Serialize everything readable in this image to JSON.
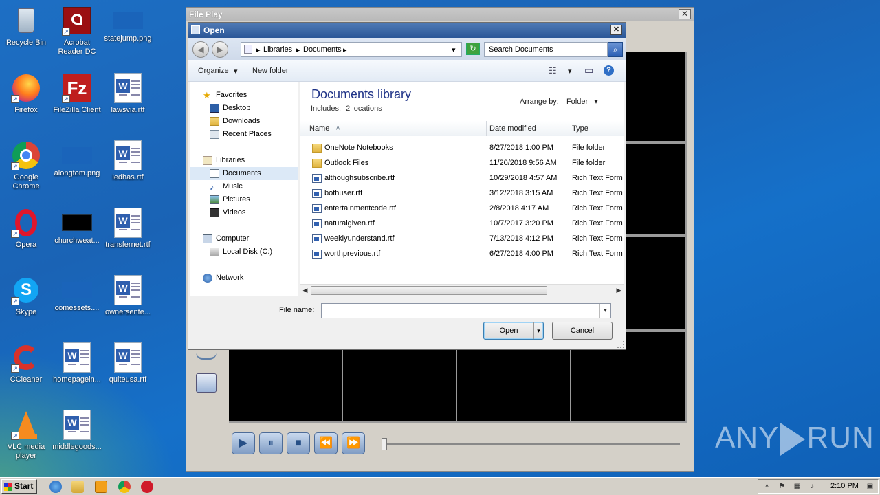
{
  "desktop": {
    "icons": [
      {
        "label": "Recycle Bin"
      },
      {
        "label": "Acrobat Reader DC"
      },
      {
        "label": "statejump.png"
      },
      {
        "label": "Firefox"
      },
      {
        "label": "FileZilla Client"
      },
      {
        "label": "lawsvia.rtf"
      },
      {
        "label": "Google Chrome"
      },
      {
        "label": "alongtom.png"
      },
      {
        "label": "ledhas.rtf"
      },
      {
        "label": "Opera"
      },
      {
        "label": "churchweat..."
      },
      {
        "label": "transfernet.rtf"
      },
      {
        "label": "Skype"
      },
      {
        "label": "comessets...."
      },
      {
        "label": "ownersente..."
      },
      {
        "label": "CCleaner"
      },
      {
        "label": "homepagein..."
      },
      {
        "label": "quiteusa.rtf"
      },
      {
        "label": "VLC media player"
      },
      {
        "label": "middlegoods..."
      }
    ],
    "watermark": {
      "left": "ANY",
      "right": "RUN"
    }
  },
  "file_play": {
    "title": "File Play",
    "close_glyph": "✕",
    "controls": {
      "play": "▶",
      "pause": "⏸",
      "stop": "■",
      "rewind": "⏪",
      "forward": "⏩"
    }
  },
  "open_dialog": {
    "title": "Open",
    "close_glyph": "✕",
    "back_glyph": "◀",
    "forward_glyph": "▶",
    "breadcrumb": {
      "part1": "Libraries",
      "part2": "Documents",
      "sep": "▸",
      "dropdown": "▾"
    },
    "refresh_glyph": "↻",
    "search_placeholder": "Search Documents",
    "search_glyph": "⌕",
    "toolbar": {
      "organize": "Organize",
      "new_folder": "New folder",
      "dropdown": "▾",
      "help": "?",
      "views_glyph": "☷",
      "preview_glyph": "▭"
    },
    "nav": {
      "favorites": "Favorites",
      "desktop": "Desktop",
      "downloads": "Downloads",
      "recent_places": "Recent Places",
      "libraries": "Libraries",
      "documents": "Documents",
      "music": "Music",
      "pictures": "Pictures",
      "videos": "Videos",
      "computer": "Computer",
      "local_disk": "Local Disk (C:)",
      "network": "Network"
    },
    "library": {
      "title": "Documents library",
      "includes_label": "Includes:",
      "includes_value": "2 locations",
      "arrange_label": "Arrange by:",
      "arrange_value": "Folder",
      "arrange_dropdown": "▾"
    },
    "columns": {
      "name": "Name",
      "sort_glyph": "˄",
      "date_modified": "Date modified",
      "type": "Type"
    },
    "files": [
      {
        "name": "OneNote Notebooks",
        "date": "8/27/2018 1:00 PM",
        "type": "File folder",
        "icon": "folder-icon"
      },
      {
        "name": "Outlook Files",
        "date": "11/20/2018 9:56 AM",
        "type": "File folder",
        "icon": "folder-icon"
      },
      {
        "name": "althoughsubscribe.rtf",
        "date": "10/29/2018 4:57 AM",
        "type": "Rich Text Forma",
        "icon": "rtf-file-icon"
      },
      {
        "name": "bothuser.rtf",
        "date": "3/12/2018 3:15 AM",
        "type": "Rich Text Forma",
        "icon": "rtf-file-icon"
      },
      {
        "name": "entertainmentcode.rtf",
        "date": "2/8/2018 4:17 AM",
        "type": "Rich Text Forma",
        "icon": "rtf-file-icon"
      },
      {
        "name": "naturalgiven.rtf",
        "date": "10/7/2017 3:20 PM",
        "type": "Rich Text Forma",
        "icon": "rtf-file-icon"
      },
      {
        "name": "weeklyunderstand.rtf",
        "date": "7/13/2018 4:12 PM",
        "type": "Rich Text Forma",
        "icon": "rtf-file-icon"
      },
      {
        "name": "worthprevious.rtf",
        "date": "6/27/2018 4:00 PM",
        "type": "Rich Text Forma",
        "icon": "rtf-file-icon"
      }
    ],
    "scroll": {
      "left": "◀",
      "right": "▶"
    },
    "file_name_label": "File name:",
    "file_name_value": "",
    "file_name_dropdown": "▾",
    "open_button": "Open",
    "open_split": "▾",
    "cancel_button": "Cancel"
  },
  "taskbar": {
    "start": "Start",
    "tray": {
      "chevron": "˄",
      "flag": "⚑",
      "net": "▦",
      "volume": "♪",
      "power": "▣"
    },
    "clock": "2:10 PM"
  }
}
